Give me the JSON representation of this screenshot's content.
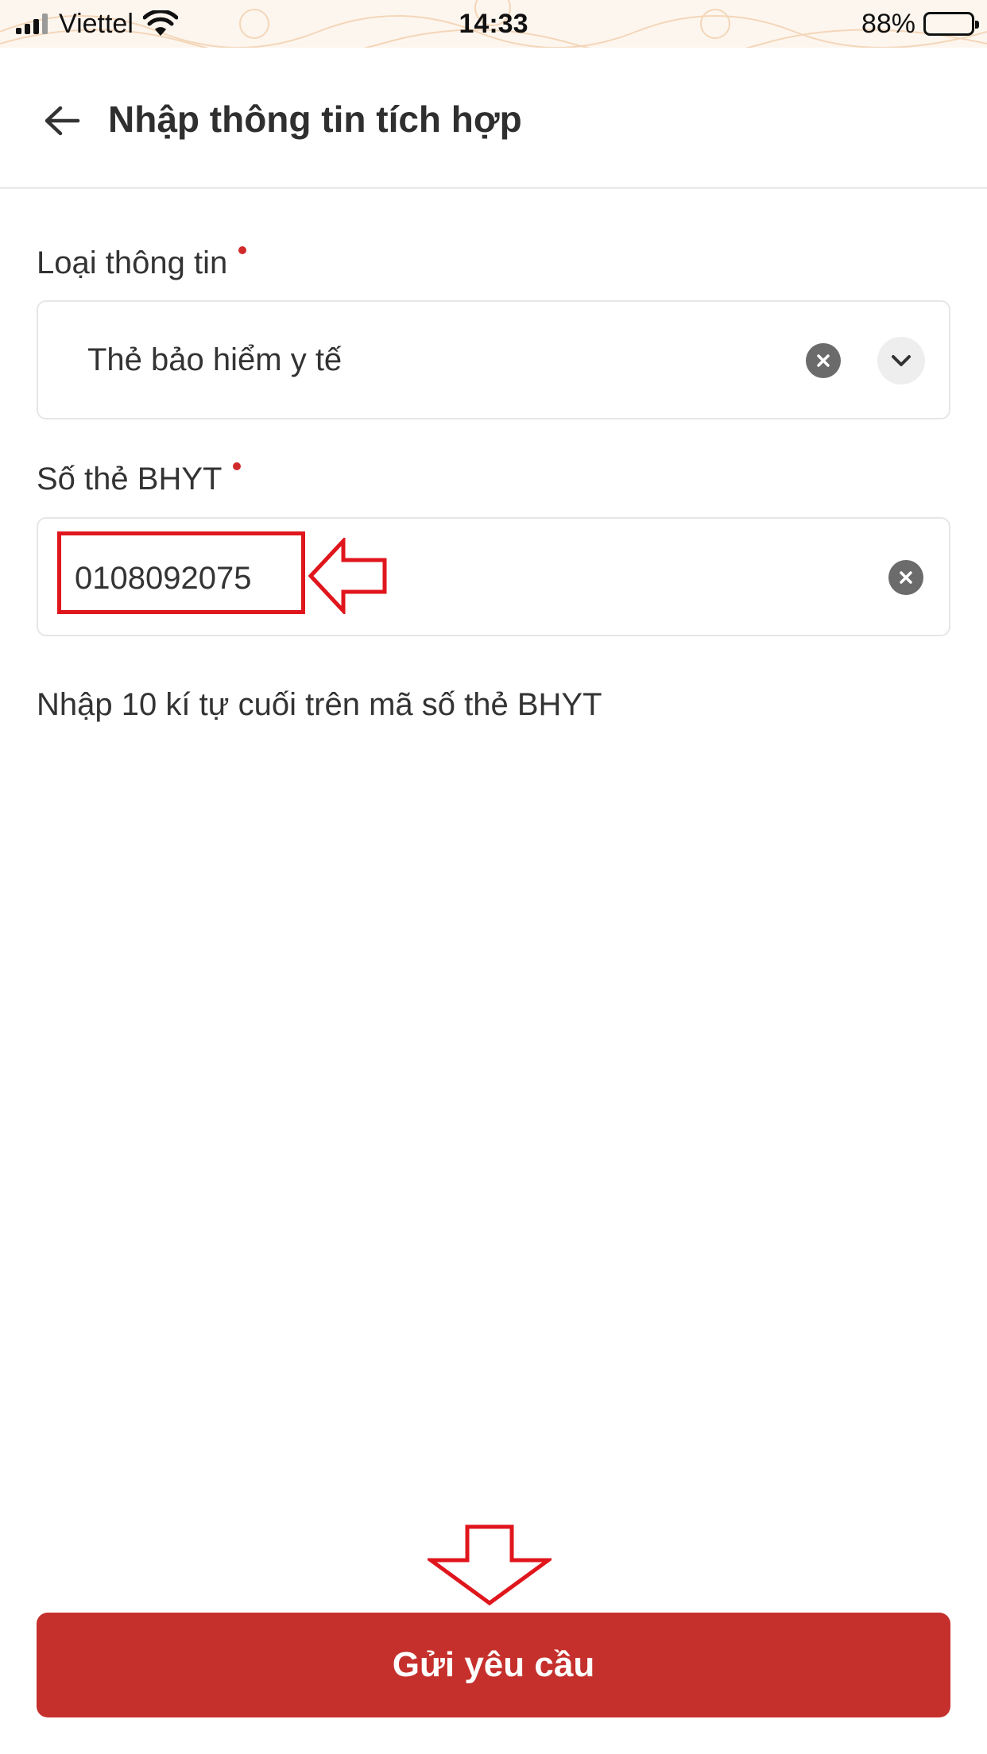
{
  "status_bar": {
    "carrier": "Viettel",
    "time": "14:33",
    "battery_percent": "88%",
    "battery_level": 0.88,
    "icons": [
      "signal-icon",
      "wifi-icon",
      "battery-icon"
    ]
  },
  "header": {
    "title": "Nhập thông tin tích hợp",
    "back_icon": "arrow-left-icon"
  },
  "form": {
    "info_type": {
      "label": "Loại thông tin",
      "required": true,
      "selected_value": "Thẻ bảo hiểm y tế",
      "icons": [
        "clear-icon",
        "chevron-down-icon"
      ]
    },
    "card_number": {
      "label": "Số thẻ BHYT",
      "required": true,
      "value": "0108092075",
      "icons": [
        "clear-icon"
      ]
    },
    "hint": "Nhập 10 kí tự cuối trên mã số thẻ BHYT"
  },
  "submit": {
    "label": "Gửi yêu cầu"
  },
  "colors": {
    "primary": "#c5302c",
    "required_dot": "#d12a2a",
    "annotation": "#e0161d",
    "status_bar_bg": "#fdf6ee"
  }
}
